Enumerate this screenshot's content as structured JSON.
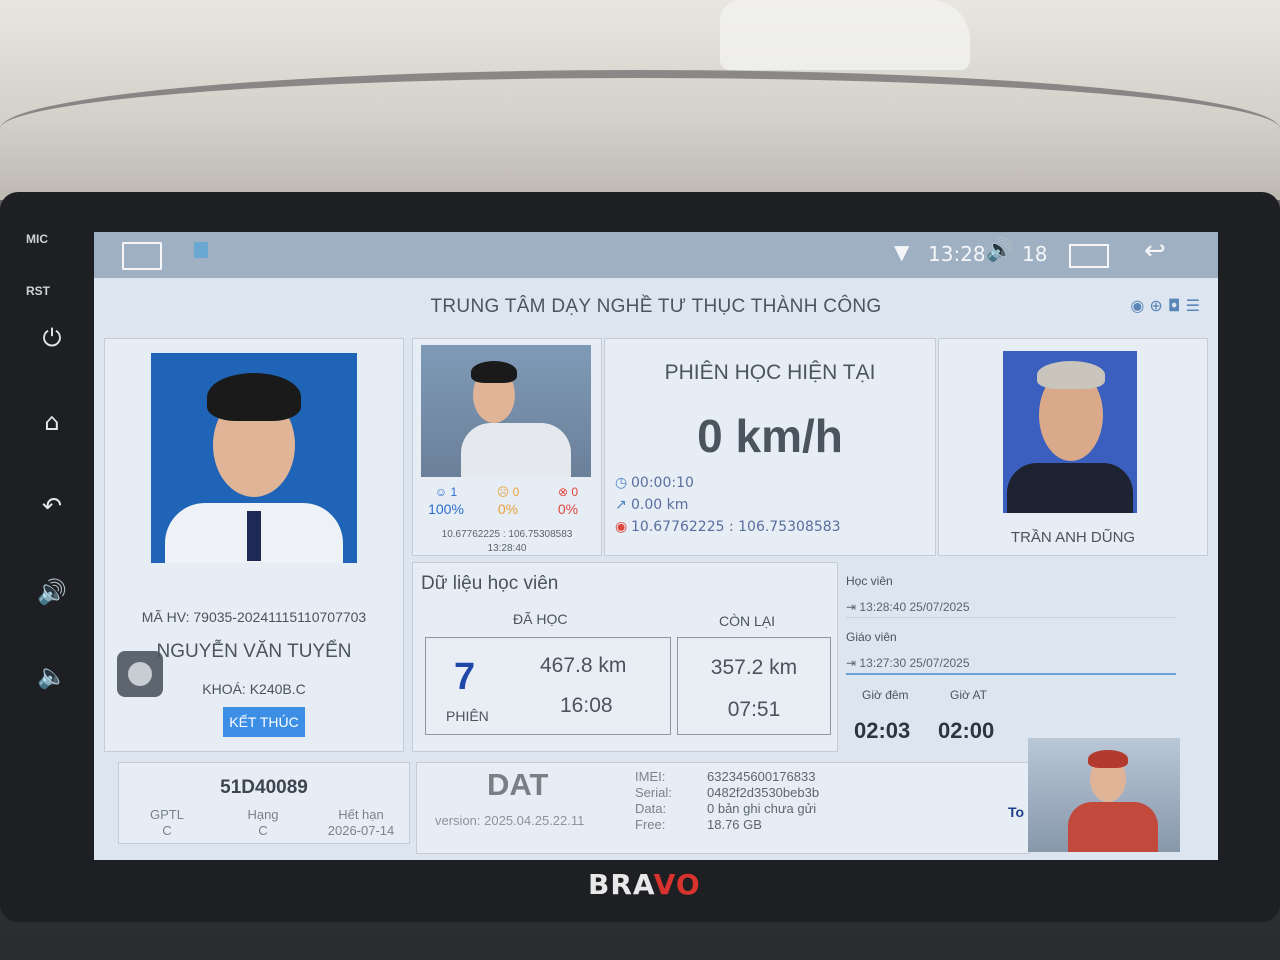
{
  "side": {
    "mic_label": "MIC",
    "rst_label": "RST",
    "brand_prefix": "BRA",
    "brand_suffix": "VO"
  },
  "statusbar": {
    "time": "13:28",
    "volume": "18"
  },
  "header": {
    "center_name": "TRUNG TÂM DẠY NGHỀ TƯ THỤC THÀNH CÔNG"
  },
  "student": {
    "ma_hv": "MÃ HV: 79035-20241115110707703",
    "name": "NGUYỄN VĂN TUYỂN",
    "khoa": "KHOÁ: K240B.C",
    "end_button": "KẾT THÚC"
  },
  "camera": {
    "stat1_count": "1",
    "stat1_pct": "100%",
    "stat2_count": "0",
    "stat2_pct": "0%",
    "stat3_count": "0",
    "stat3_pct": "0%",
    "coords": "10.67762225 : 106.75308583",
    "time": "13:28:40"
  },
  "session": {
    "title": "PHIÊN HỌC HIỆN TẠI",
    "speed": "0 km/h",
    "duration": "00:00:10",
    "distance": "0.00 km",
    "coords": "10.67762225 : 106.75308583"
  },
  "teacher": {
    "name": "TRẦN ANH DŨNG"
  },
  "student_data": {
    "title": "Dữ liệu học viên",
    "da_hoc_label": "ĐÃ HỌC",
    "con_lai_label": "CÒN LẠI",
    "sessions": "7",
    "sessions_label": "PHIÊN",
    "km_done": "467.8 km",
    "time_done": "16:08",
    "km_left": "357.2 km",
    "time_left": "07:51"
  },
  "login": {
    "student_label": "Học viên",
    "student_time": "13:28:40 25/07/2025",
    "teacher_label": "Giáo viên",
    "teacher_time": "13:27:30 25/07/2025",
    "night_label": "Giờ đêm",
    "at_label": "Giờ AT",
    "night_value": "02:03",
    "at_value": "02:00"
  },
  "vehicle": {
    "plate": "51D40089",
    "gptl_label": "GPTL",
    "gptl_value": "C",
    "hang_label": "Hạng",
    "hang_value": "C",
    "expiry_label": "Hết hạn",
    "expiry_value": "2026-07-14"
  },
  "device": {
    "logo": "DAT",
    "version": "version: 2025.04.25.22.11",
    "imei_label": "IMEI:",
    "imei_value": "632345600176833",
    "serial_label": "Serial:",
    "serial_value": "0482f2d3530beb3b",
    "data_label": "Data:",
    "data_value": "0 bản ghi chưa gửi",
    "free_label": "Free:",
    "free_value": "18.76 GB",
    "to_text": "To"
  },
  "colors": {
    "accent": "#3d8fe6",
    "stat_green": "#2a6ed0",
    "stat_orange": "#e8a13c",
    "stat_red": "#e0463c"
  }
}
